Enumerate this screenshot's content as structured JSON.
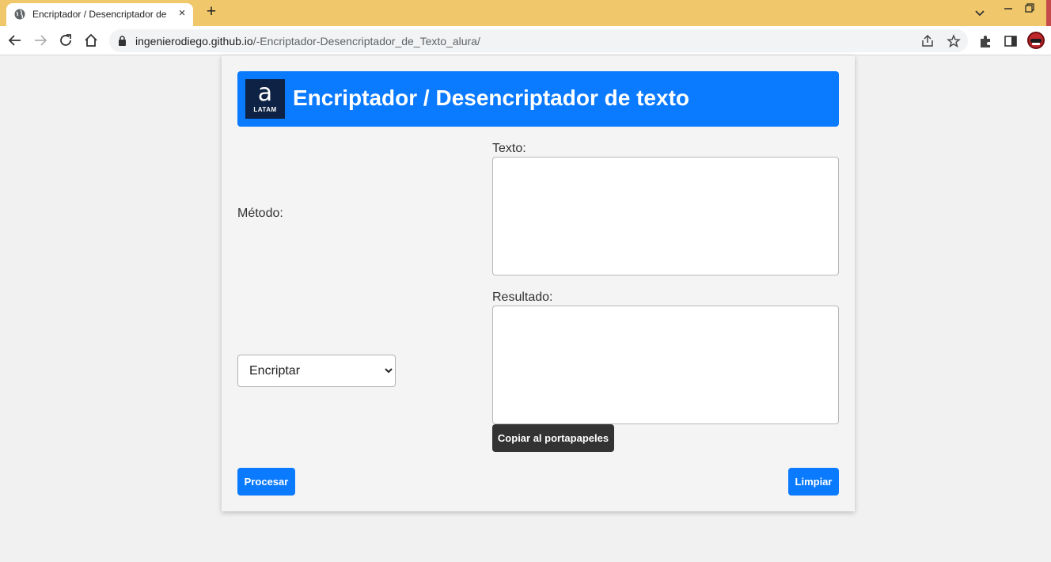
{
  "browser": {
    "tab_title": "Encriptador / Desencriptador de texto",
    "tab_close": "×",
    "new_tab": "+",
    "url_host": "ingenierodiego.github.io",
    "url_path": "/-Encriptador-Desencriptador_de_Texto_alura/"
  },
  "header": {
    "logo_glyph": "a",
    "logo_sub": "LATAM",
    "title": "Encriptador / Desencriptador de texto"
  },
  "form": {
    "method_label": "Método:",
    "texto_label": "Texto:",
    "texto_value": "",
    "resultado_label": "Resultado:",
    "resultado_value": "",
    "method_options": [
      "Encriptar"
    ],
    "method_selected": "Encriptar",
    "copy_button": "Copiar al portapapeles",
    "process_button": "Procesar",
    "clear_button": "Limpiar"
  },
  "colors": {
    "tabstrip": "#f0c86b",
    "header_blue": "#0a7aff",
    "logo_navy": "#0d2244",
    "copy_button_bg": "#333333"
  }
}
